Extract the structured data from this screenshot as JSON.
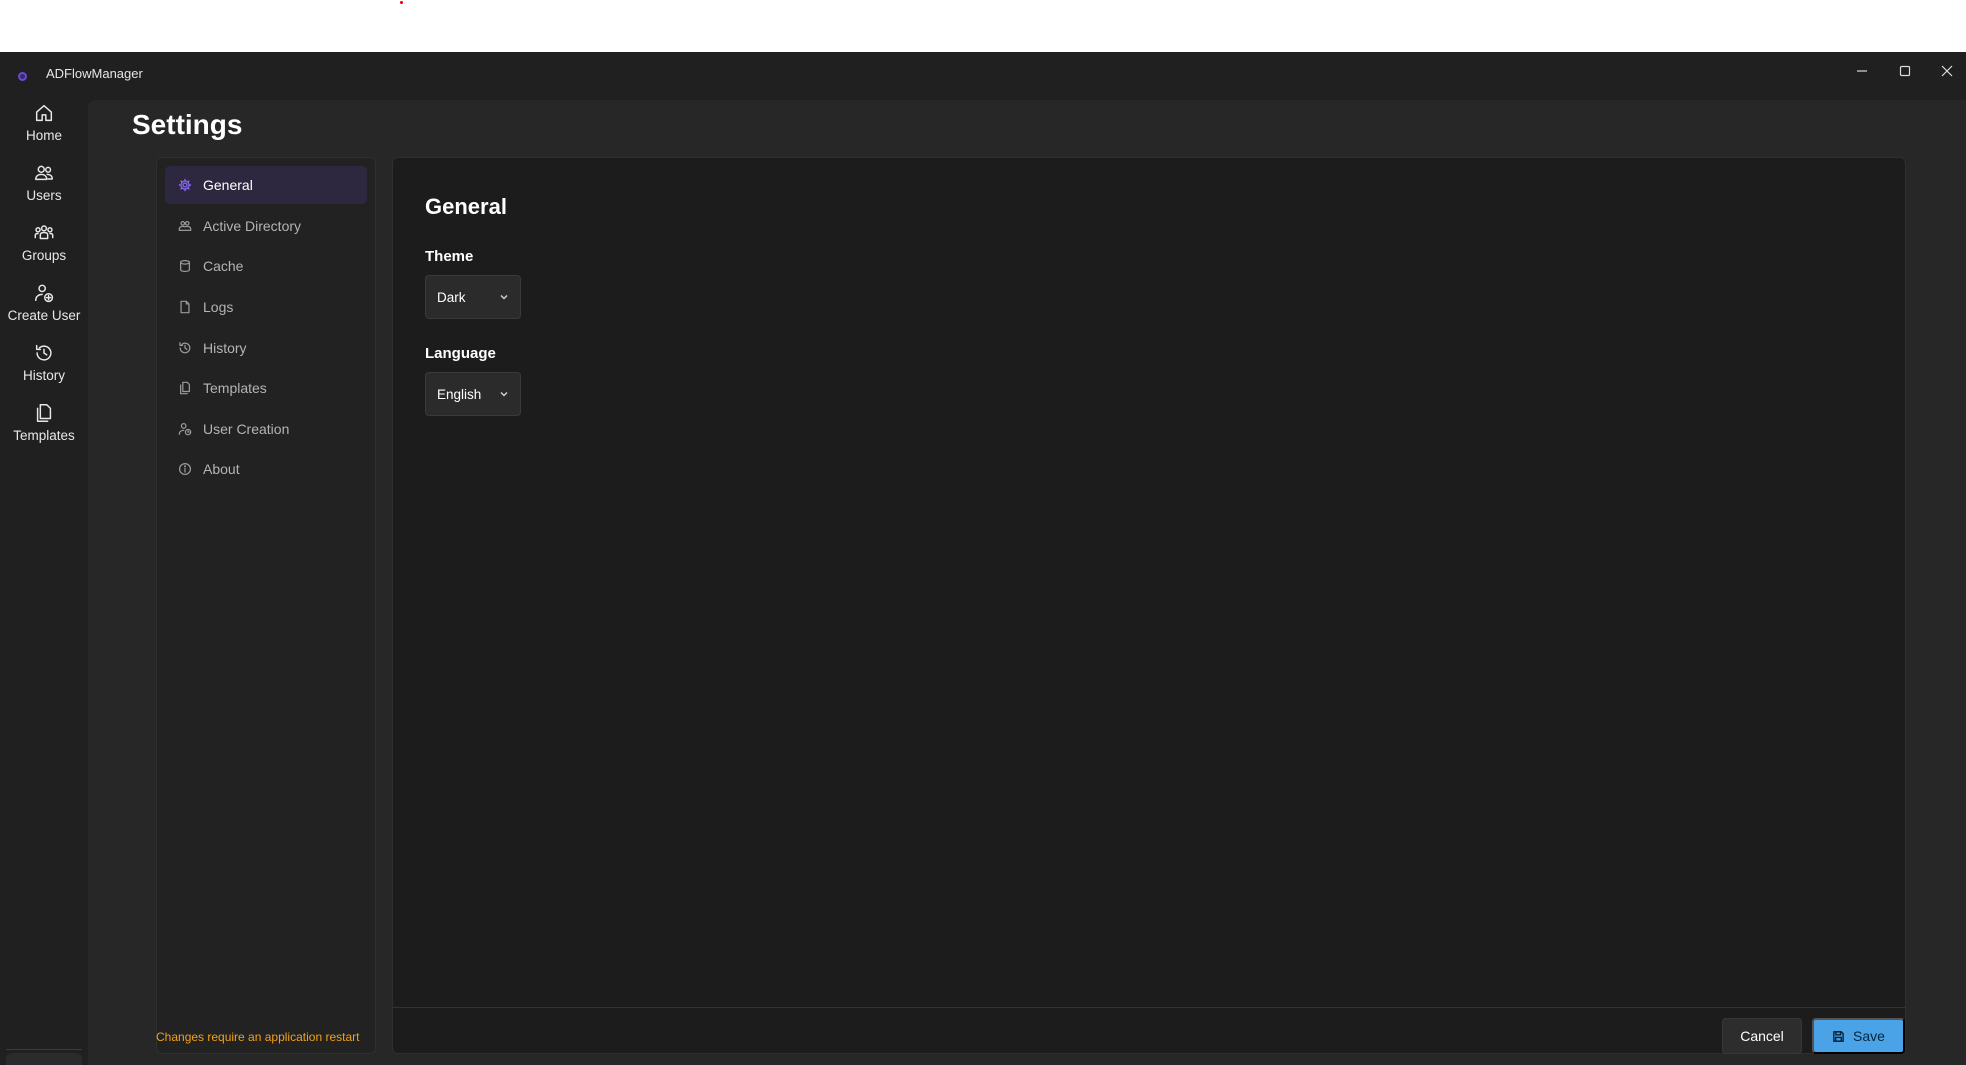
{
  "app": {
    "title": "ADFlowManager"
  },
  "nav": {
    "items": [
      {
        "label": "Home",
        "icon": "home-icon"
      },
      {
        "label": "Users",
        "icon": "users-icon"
      },
      {
        "label": "Groups",
        "icon": "groups-icon"
      },
      {
        "label": "Create User",
        "icon": "create-user-icon"
      },
      {
        "label": "History",
        "icon": "history-icon"
      },
      {
        "label": "Templates",
        "icon": "templates-icon"
      }
    ],
    "settings_icon": "gear-icon",
    "accent": "#60cdff"
  },
  "page": {
    "title": "Settings"
  },
  "settings_menu": {
    "active": "General",
    "items": [
      {
        "label": "General",
        "icon": "gear-icon"
      },
      {
        "label": "Active Directory",
        "icon": "directory-icon"
      },
      {
        "label": "Cache",
        "icon": "database-icon"
      },
      {
        "label": "Logs",
        "icon": "document-icon"
      },
      {
        "label": "History",
        "icon": "history-icon"
      },
      {
        "label": "Templates",
        "icon": "templates-icon"
      },
      {
        "label": "User Creation",
        "icon": "user-creation-icon"
      },
      {
        "label": "About",
        "icon": "info-icon"
      }
    ],
    "active_color": "#8f6bff"
  },
  "general": {
    "title": "General",
    "theme": {
      "label": "Theme",
      "value": "Dark"
    },
    "language": {
      "label": "Language",
      "value": "English"
    }
  },
  "footer": {
    "restart_note": "Changes require an application restart",
    "restart_note_color": "#f0a01e",
    "cancel_label": "Cancel",
    "save_label": "Save",
    "save_color": "#4aa3e6"
  }
}
